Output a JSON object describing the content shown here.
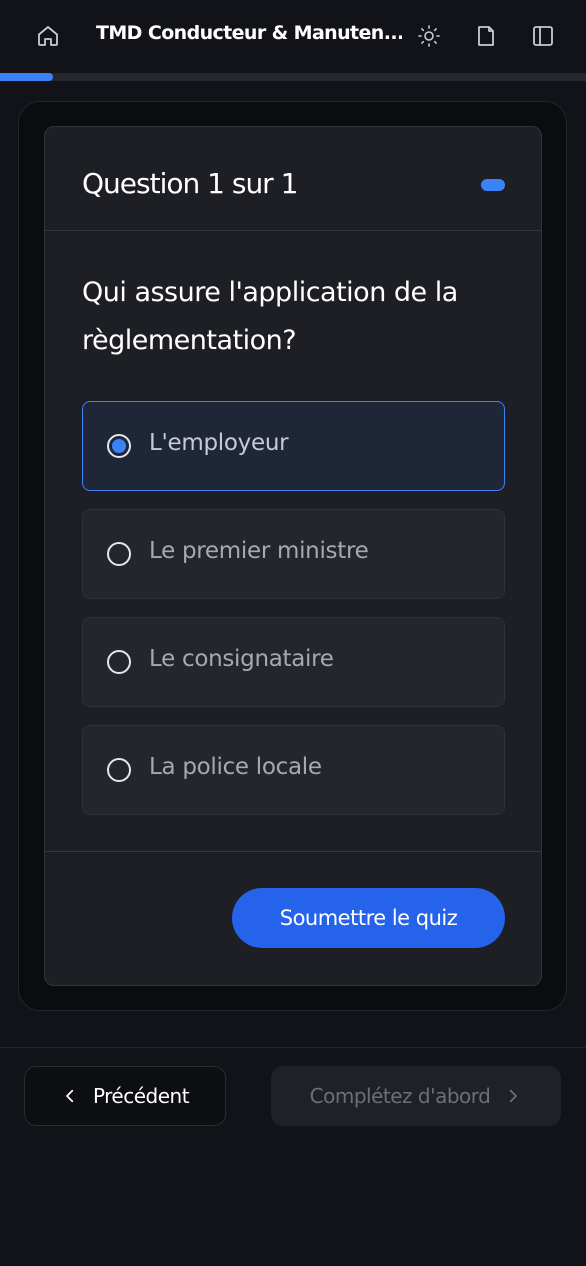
{
  "header": {
    "title": "TMD Conducteur & Manuten...",
    "icons": [
      "home-icon",
      "sun-icon",
      "document-icon",
      "sidebar-toggle-icon"
    ]
  },
  "progress": {
    "percent": 9
  },
  "quiz": {
    "counter": "Question 1 sur 1",
    "question": "Qui assure l'application de la règlementation?",
    "options": [
      {
        "label": "L'employeur",
        "selected": true
      },
      {
        "label": "Le premier ministre",
        "selected": false
      },
      {
        "label": "Le consignataire",
        "selected": false
      },
      {
        "label": "La police locale",
        "selected": false
      }
    ],
    "submit_label": "Soumettre le quiz"
  },
  "navigation": {
    "prev_label": "Précédent",
    "next_label": "Complétez d'abord"
  },
  "colors": {
    "accent": "#3b82f6",
    "button": "#2563eb",
    "background": "#111318",
    "card": "#1d1f24"
  }
}
